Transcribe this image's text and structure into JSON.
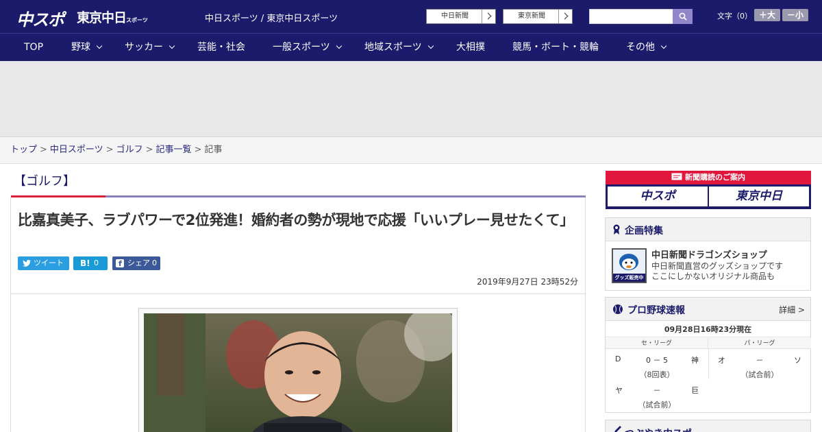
{
  "header": {
    "logo_primary": "中スポ",
    "logo_secondary": "東京中日",
    "logo_secondary_sub": "スポーツ",
    "caption": "中日スポーツ / 東京中日スポーツ",
    "paper_links": [
      "中日新聞",
      "東京新聞"
    ],
    "search_placeholder": "",
    "font_size_label": "文字（0）",
    "font_up": "＋大",
    "font_down": "－小"
  },
  "nav": {
    "items": [
      {
        "label": "TOP",
        "dropdown": false
      },
      {
        "label": "野球",
        "dropdown": true
      },
      {
        "label": "サッカー",
        "dropdown": true
      },
      {
        "label": "芸能・社会",
        "dropdown": false
      },
      {
        "label": "一般スポーツ",
        "dropdown": true
      },
      {
        "label": "地域スポーツ",
        "dropdown": true
      },
      {
        "label": "大相撲",
        "dropdown": false
      },
      {
        "label": "競馬・ボート・競輪",
        "dropdown": false
      },
      {
        "label": "その他",
        "dropdown": true
      }
    ]
  },
  "breadcrumb": {
    "items": [
      "トップ",
      "中日スポーツ",
      "ゴルフ",
      "記事一覧"
    ],
    "current": "記事",
    "separator": ">"
  },
  "article": {
    "category": "【ゴルフ】",
    "title": "比嘉真美子、ラブパワーで2位発進！婚約者の勢が現地で応援「いいプレー見せたくて」",
    "share": {
      "tweet_label": "ツイート",
      "hatena_label": "B!",
      "hatena_count": "0",
      "facebook_label": "シェア",
      "facebook_count": "0"
    },
    "date": "2019年9月27日 23時52分"
  },
  "sidebar": {
    "subscribe": {
      "bar_text": "新聞購読のご案内",
      "logo_left": "中スポ",
      "logo_right": "東京中日"
    },
    "feature": {
      "title": "企画特集",
      "item_title": "中日新聞ドラゴンズショップ",
      "item_desc_1": "中日新聞直営のグッズショップです",
      "item_desc_2": "ここにしかないオリジナル商品も",
      "thumb_caption": "グッズ販売中"
    },
    "baseball": {
      "title": "プロ野球速報",
      "more": "詳細 >",
      "updated": "09月28日16時23分現在",
      "central_label": "セ・リーグ",
      "pacific_label": "パ・リーグ",
      "games": [
        {
          "team1": "D",
          "score": "0 － 5",
          "team2": "神",
          "status": "（8回表）"
        },
        {
          "team1": "オ",
          "score": "－",
          "team2": "ソ",
          "status": "（試合前）"
        },
        {
          "team1": "ヤ",
          "score": "－",
          "team2": "巨",
          "status": "（試合前）"
        }
      ]
    },
    "next_box_title": "つぶやき中スポ"
  },
  "colors": {
    "header_bg": "#1b1a6b",
    "accent_red": "#d81f36",
    "accent_purple": "#8a7fb8"
  }
}
